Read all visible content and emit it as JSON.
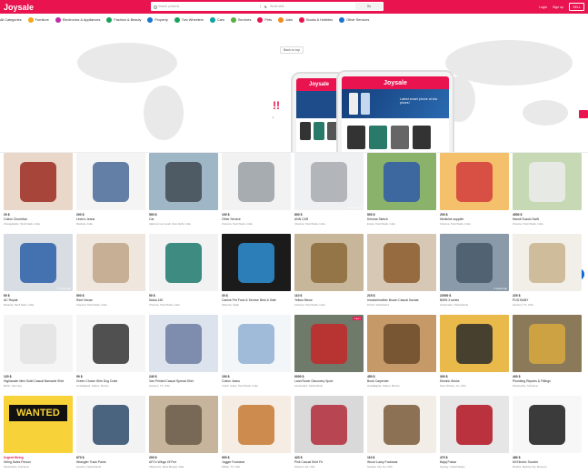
{
  "header": {
    "logo": "Joysale",
    "search_placeholder": "Search products",
    "location_placeholder": "World wide",
    "search_button": "Go",
    "links": [
      "Login",
      "Sign up",
      "SELL"
    ]
  },
  "categories": [
    {
      "label": "All Categories",
      "color": "#ffffff"
    },
    {
      "label": "Furniture",
      "color": "#f2a818"
    },
    {
      "label": "Electronics & Appliances",
      "color": "#c32aa9"
    },
    {
      "label": "Fashion & Beauty",
      "color": "#18a35b"
    },
    {
      "label": "Property",
      "color": "#1976d2"
    },
    {
      "label": "Two Wheelers",
      "color": "#18a35b"
    },
    {
      "label": "Cars",
      "color": "#0aa5a0"
    },
    {
      "label": "Services",
      "color": "#59b13d"
    },
    {
      "label": "Pets",
      "color": "#e8134f"
    },
    {
      "label": "Jobs",
      "color": "#f08c1a"
    },
    {
      "label": "Books & Hobbies",
      "color": "#e8134f"
    },
    {
      "label": "Other Services",
      "color": "#1976d2"
    }
  ],
  "hero": {
    "back_to_top": "Back to top",
    "phone_brand": "Joysale",
    "phone_caption": "Latest smart phone at low prices!"
  },
  "colors": {
    "brand": "#e8134f",
    "chat": "#0a66d8"
  },
  "items": [
    {
      "price": "20 $",
      "title": "Cotton Churidhar",
      "loc": "Chengalpattu, Tamil Nadu, India",
      "bg": "#e9d7c9",
      "fg": "#9b2b22",
      "ago": ""
    },
    {
      "price": "200 $",
      "title": "Levis's Jeans",
      "loc": "Madurai, India",
      "bg": "#f4f4f4",
      "fg": "#4a6a96",
      "ago": ""
    },
    {
      "price": "500 $",
      "title": "Car",
      "loc": "Alaimoni-Lai mondi, New Delhi, India",
      "bg": "#9eb6c6",
      "fg": "#3f4a52",
      "ago": ""
    },
    {
      "price": "100 $",
      "title": "Other Service",
      "loc": "Chennai, Tamil Nadu, India",
      "bg": "#f2f2f2",
      "fg": "#9aa0a6",
      "ago": ""
    },
    {
      "price": "800 $",
      "title": "ANN CAR",
      "loc": "Chennai, Tamil Nadu, India",
      "bg": "#eef0f2",
      "fg": "#a7aab0",
      "ago": "7 months ago"
    },
    {
      "price": "500 $",
      "title": "Krishna Sketch",
      "loc": "Erode, Tamil Nadu, India",
      "bg": "#8ab26a",
      "fg": "#2f5aa8",
      "ago": ""
    },
    {
      "price": "200 $",
      "title": "Medicine supplier",
      "loc": "Chennai, Tamil Nadu, India",
      "bg": "#f4c06b",
      "fg": "#d23c3c",
      "ago": ""
    },
    {
      "price": "4500 $",
      "title": "Maruti Suzuki Swift",
      "loc": "Chennai, Tamil Nadu, India",
      "bg": "#c7d9b4",
      "fg": "#ececec",
      "ago": ""
    },
    {
      "price": "60 $",
      "title": "AC Repair",
      "loc": "Madurai, Tamil Nadu, India",
      "bg": "#d8dde3",
      "fg": "#2a5fa8",
      "ago": "7 months ago"
    },
    {
      "price": "500 $",
      "title": "Rent House",
      "loc": "Chennai, Tamil Nadu, India",
      "bg": "#efe7dd",
      "fg": "#bfa58a",
      "ago": ""
    },
    {
      "price": "50 $",
      "title": "Nokia 150",
      "loc": "Chennai, Tamil Nadu, India",
      "bg": "#f2f2f2",
      "fg": "#1f7a6d",
      "ago": ""
    },
    {
      "price": "30 $",
      "title": "Canine Pet Food & Service Best & Safe",
      "loc": "Valencia, Spain",
      "bg": "#1b1b1b",
      "fg": "#2e8fd3",
      "ago": ""
    },
    {
      "price": "110 $",
      "title": "Yellow Meow",
      "loc": "Chennai, Tamil Nadu, India",
      "bg": "#c8b69a",
      "fg": "#8a6a3a",
      "ago": ""
    },
    {
      "price": "215 $",
      "title": "Imodunheather Brown Casual Sandal",
      "loc": "Zurich, Switzerland",
      "bg": "#d6c8b4",
      "fg": "#8a5a2a",
      "ago": ""
    },
    {
      "price": "22000 $",
      "title": "BMW 3 series",
      "loc": "Amsterdam, Netherlands",
      "bg": "#8a9aa8",
      "fg": "#46586a",
      "ago": "2 weeks ago"
    },
    {
      "price": "220 $",
      "title": "PUG BABY",
      "loc": "Houston, TX, USA",
      "bg": "#f2efe9",
      "fg": "#c9b38c",
      "ago": ""
    },
    {
      "price": "120 $",
      "title": "Highlander Men Solid Casual Barnacle Shirt",
      "loc": "Berlin, Germany",
      "bg": "#f5f5f5",
      "fg": "#e3e3e3",
      "ago": ""
    },
    {
      "price": "90 $",
      "title": "Green Choice Wire Dog Crate",
      "loc": "Guadalajara, Jalisco, Mexico",
      "bg": "#f5f5f5",
      "fg": "#333333",
      "ago": ""
    },
    {
      "price": "240 $",
      "title": "Van Printed Casual Spread Shirt",
      "loc": "Houston, TX, USA",
      "bg": "#dde3ec",
      "fg": "#6d7ea3",
      "ago": ""
    },
    {
      "price": "190 $",
      "title": "Cotton Jeans",
      "loc": "Cotton Jeans, Tamil Nadu, India",
      "bg": "#f3f6f9",
      "fg": "#8fb0d4",
      "ago": ""
    },
    {
      "price": "9000 $",
      "title": "Land Rover Discovery Sport",
      "loc": "Amsterdam, Netherlands",
      "bg": "#6f7a6a",
      "fg": "#c62828",
      "ago": "",
      "badge": "Urgent"
    },
    {
      "price": "450 $",
      "title": "Book Carpenter",
      "loc": "Guadalajara, Jalisco, Mexico",
      "bg": "#c59a68",
      "fg": "#6b4a2a",
      "ago": ""
    },
    {
      "price": "300 $",
      "title": "Electric Works",
      "loc": "New Orleans, LA, USA",
      "bg": "#e9b94a",
      "fg": "#2a2a2a",
      "ago": ""
    },
    {
      "price": "400 $",
      "title": "Plumbing Repairs & Fittings",
      "loc": "Paramaribo, Suriname",
      "bg": "#8a7a5a",
      "fg": "#d8a940",
      "ago": ""
    },
    {
      "price": "Urgent Hiring",
      "title": "Hiring Sales Person",
      "loc": "Paramaribo, Suriname",
      "bg": "#f7d238",
      "fg": "#111111",
      "ago": "",
      "is_wanted": true,
      "wanted_text": "WANTED"
    },
    {
      "price": "670 $",
      "title": "Wrangler Track Pants",
      "loc": "Houston, Netherlands",
      "bg": "#f3f3f3",
      "fg": "#2c4a6a",
      "ago": ""
    },
    {
      "price": "200 $",
      "title": "APJ's Wings Of Fire",
      "loc": "Villupuram, West Bengal, India",
      "bg": "#c6b49c",
      "fg": "#6a5a4a",
      "ago": ""
    },
    {
      "price": "900 $",
      "title": "Jogger Footwear",
      "loc": "Dallas, TX, USA",
      "bg": "#f5ede4",
      "fg": "#c67a34",
      "ago": ""
    },
    {
      "price": "420 $",
      "title": "Pink Casual Shirt Fit",
      "loc": "Phoenix, AZ, USA",
      "bg": "#d9d9d9",
      "fg": "#b02c3a",
      "ago": ""
    },
    {
      "price": "110 $",
      "title": "Wood Lucky Footwear",
      "loc": "Sweden City, NJ, USA",
      "bg": "#f2ede7",
      "fg": "#7a5a3a",
      "ago": ""
    },
    {
      "price": "470 $",
      "title": "Bajaj Pulsar",
      "loc": "Sydney, United States",
      "bg": "#e6e6e6",
      "fg": "#b1121e",
      "ago": ""
    },
    {
      "price": "480 $",
      "title": "Mi Electric Scooter",
      "loc": "Medina, Medina City, Morocco",
      "bg": "#f7f7f7",
      "fg": "#1a1a1a",
      "ago": ""
    }
  ]
}
